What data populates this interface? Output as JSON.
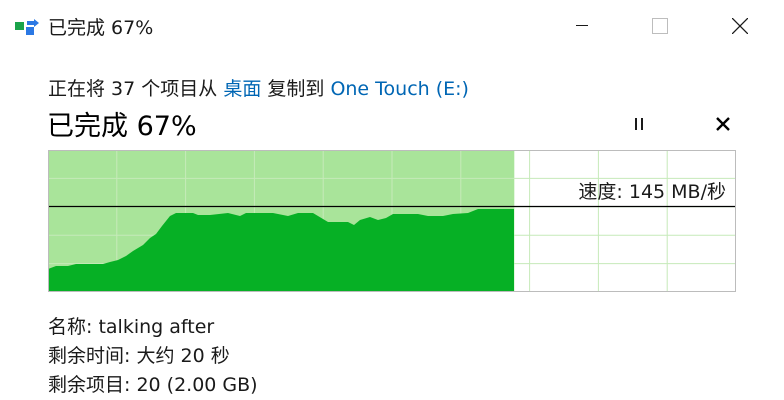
{
  "window": {
    "title": "已完成 67%",
    "controls": {
      "minimize": "minimize",
      "maximize": "maximize",
      "close": "close"
    }
  },
  "copy": {
    "prefix": "正在将 37 个项目从",
    "source": "桌面",
    "middle": "复制到",
    "destination": "One Touch",
    "drive": "(E:)"
  },
  "status": {
    "text": "已完成 67%",
    "percent": 67
  },
  "chart": {
    "speed_label": "速度: 145 MB/秒",
    "colors": {
      "done_area": "#a9e49a",
      "speed_fill": "#06b025",
      "grid": "#c6eab9",
      "border": "#bcbcbc",
      "speed_line": "#000000"
    }
  },
  "details": {
    "name_label": "名称:",
    "name_value": "talking after",
    "time_label": "剩余时间:",
    "time_value": "大约 20 秒",
    "items_label": "剩余项目:",
    "items_value": "20 (2.00 GB)"
  },
  "colors": {
    "accent_link": "#0066b4"
  }
}
